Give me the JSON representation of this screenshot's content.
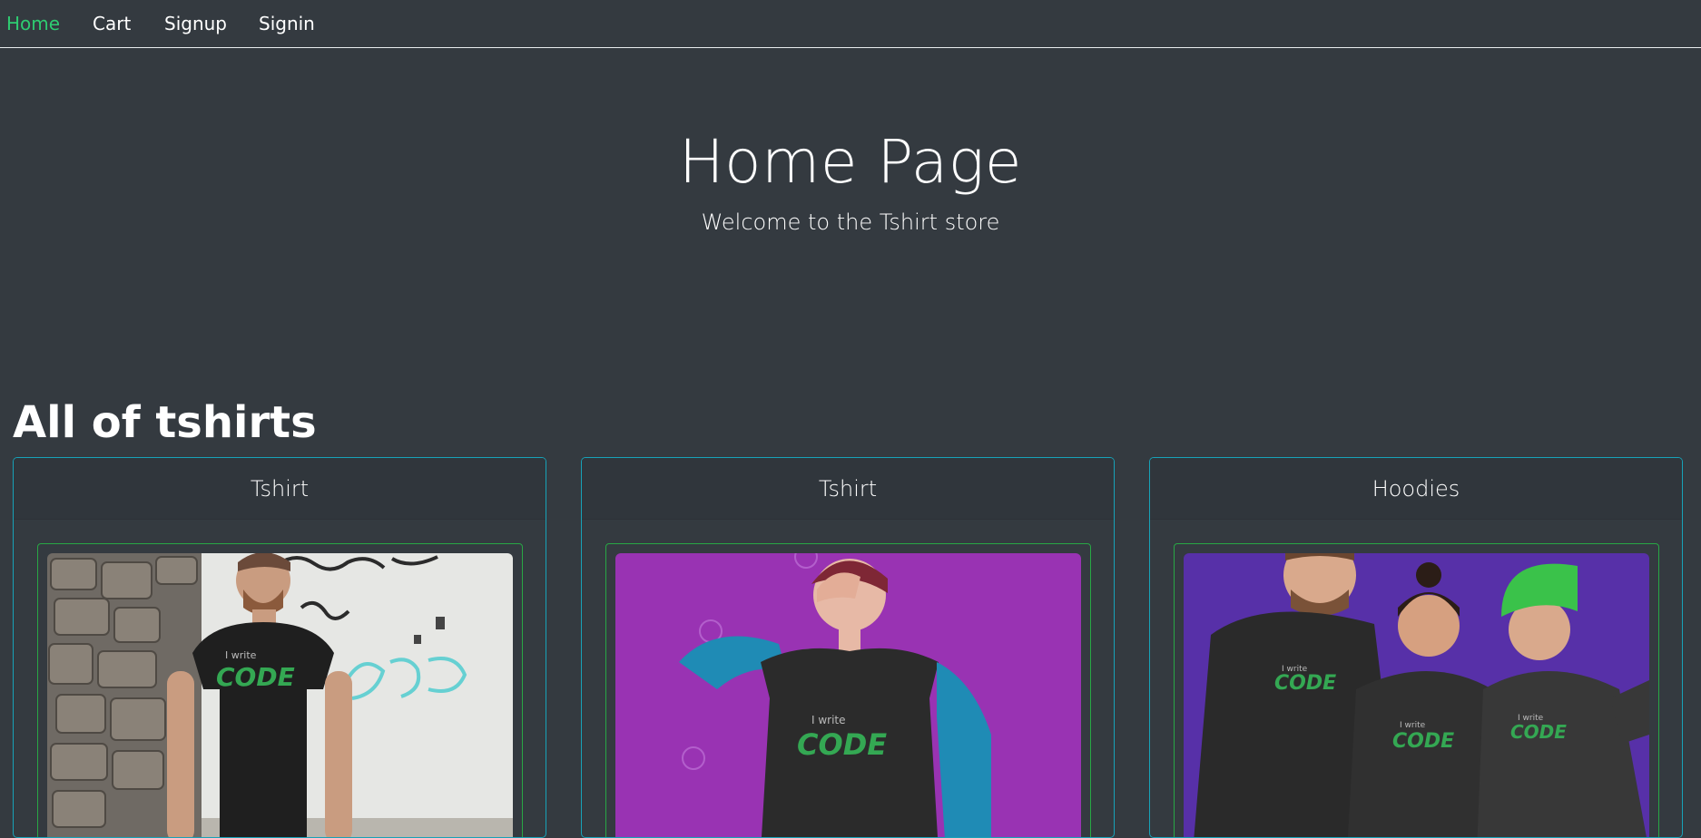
{
  "nav": {
    "items": [
      {
        "label": "Home",
        "active": true
      },
      {
        "label": "Cart",
        "active": false
      },
      {
        "label": "Signup",
        "active": false
      },
      {
        "label": "Signin",
        "active": false
      }
    ]
  },
  "jumbotron": {
    "title": "Home Page",
    "lead": "Welcome to the Tshirt store"
  },
  "section": {
    "heading": "All of tshirts"
  },
  "products": [
    {
      "name": "Tshirt",
      "image_text_small": "I write",
      "image_text_big": "CODE"
    },
    {
      "name": "Tshirt",
      "image_text_small": "I write",
      "image_text_big": "CODE"
    },
    {
      "name": "Hoodies",
      "image_text_small": "I write",
      "image_text_big": "CODE"
    }
  ],
  "colors": {
    "background": "#343a40",
    "active_nav": "#2ecc71",
    "card_border": "#17a2b8",
    "image_border": "#28a745"
  }
}
